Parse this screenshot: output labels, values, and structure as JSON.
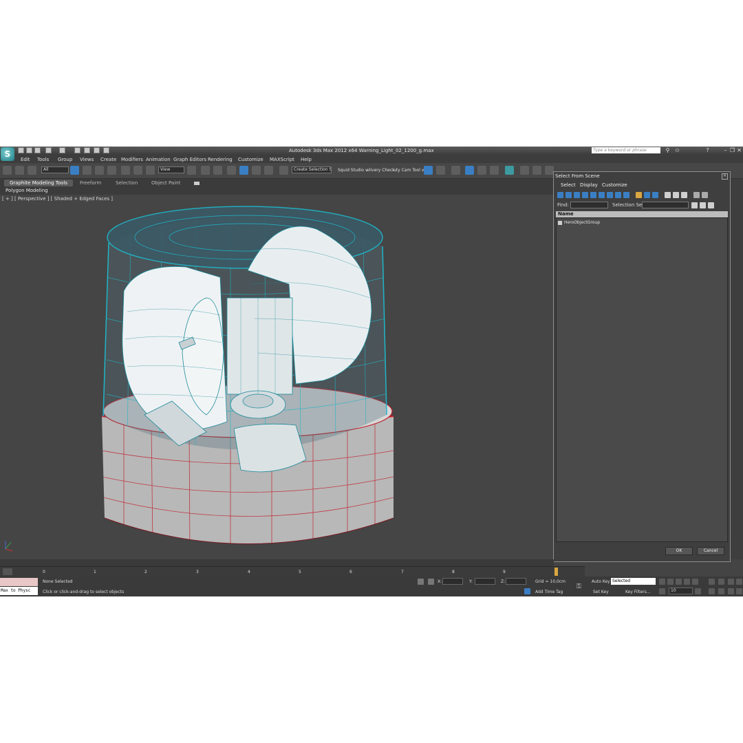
{
  "window": {
    "title": "Autodesk 3ds Max  2012 x64      Warning_Light_02_1200_g.max",
    "search_placeholder": "Type a keyword or phrase",
    "logo_glyph": "S"
  },
  "menu": [
    "Edit",
    "Tools",
    "Group",
    "Views",
    "Create",
    "Modifiers",
    "Animation",
    "Graph Editors",
    "Rendering",
    "Customize",
    "MAXScript",
    "Help"
  ],
  "toolbar": {
    "filter_value": "All",
    "ref_coord_value": "View",
    "selection_set_value": "Create Selection Se",
    "script1_label": "Squid Studio v",
    "script2_label": "elivery Check",
    "script3_label": "uty Cam Tool v"
  },
  "ribbon": {
    "tabs": [
      "Graphite Modeling Tools",
      "Freeform",
      "Selection",
      "Object Paint"
    ],
    "sub_label": "Polygon Modeling"
  },
  "viewport": {
    "label": "[ + ] [ Perspective ] [ Shaded + Edged Faces ]"
  },
  "dialog": {
    "title": "Select From Scene",
    "menu": [
      "Select",
      "Display",
      "Customize"
    ],
    "find_label": "Find:",
    "selection_set_label": "Selection Set:",
    "column_name": "Name",
    "items": [
      "HeroObjectGroup"
    ],
    "ok_label": "OK",
    "cancel_label": "Cancel"
  },
  "timeline": {
    "ticks": [
      "0",
      "1",
      "2",
      "3",
      "4",
      "5",
      "6",
      "7",
      "8",
      "9"
    ]
  },
  "status": {
    "maxscript_text": "Max to Physc",
    "selection_status": "None Selected",
    "prompt": "Click or click-and-drag to select objects",
    "x_label": "X:",
    "y_label": "Y:",
    "z_label": "Z:",
    "grid": "Grid = 10,0cm",
    "add_time_tag": "Add Time Tag",
    "auto_key": "Auto Key",
    "set_key": "Set Key",
    "key_mode_value": "Selected",
    "key_filters": "Key Filters...",
    "frame_value": "10"
  },
  "colors": {
    "wire_glass": "#1fb6c8",
    "wire_base": "#d01e2a",
    "ui_dark": "#444444",
    "accent_blue": "#3a7fc4"
  }
}
